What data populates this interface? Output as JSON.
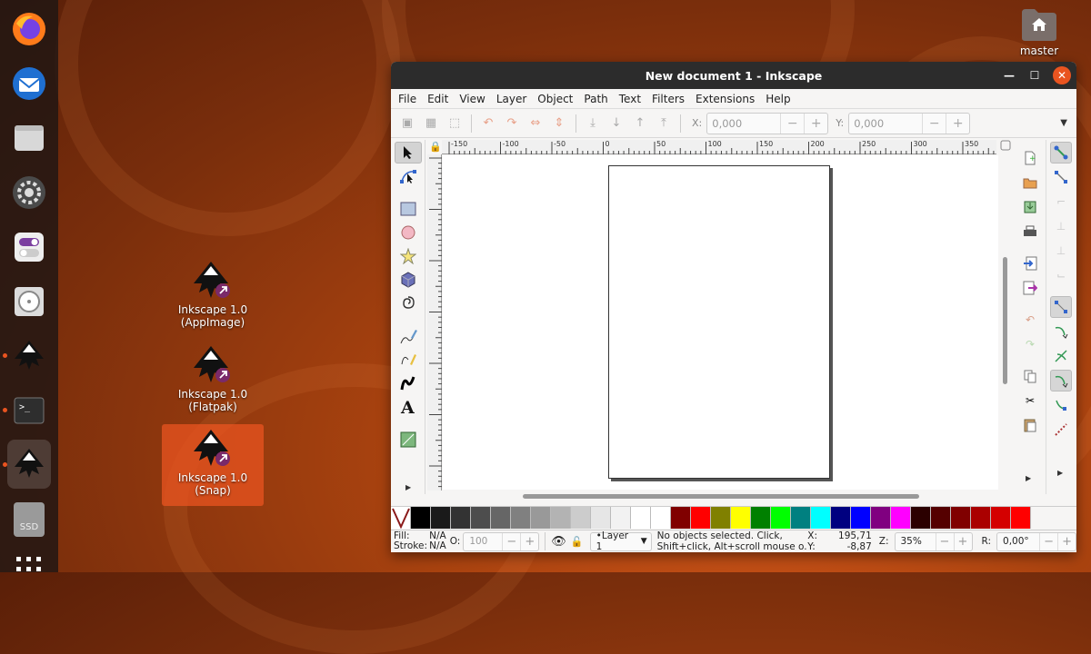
{
  "desktop": {
    "home_folder_label": "master",
    "icons": [
      {
        "label_line1": "Inkscape 1.0",
        "label_line2": "(AppImage)"
      },
      {
        "label_line1": "Inkscape 1.0",
        "label_line2": "(Flatpak)"
      },
      {
        "label_line1": "Inkscape 1.0 (Snap)",
        "label_line2": ""
      }
    ]
  },
  "dock": {
    "items": [
      "firefox-icon",
      "thunderbird-icon",
      "files-icon",
      "settings-icon",
      "tweaks-icon",
      "disks-icon",
      "inkscape-icon",
      "terminal-icon",
      "inkscape-icon",
      "ssd-icon",
      "apps-grid-icon"
    ],
    "ssd_label": "SSD"
  },
  "window": {
    "title": "New document 1 - Inkscape",
    "menu": [
      "File",
      "Edit",
      "View",
      "Layer",
      "Object",
      "Path",
      "Text",
      "Filters",
      "Extensions",
      "Help"
    ],
    "x_label": "X:",
    "x_value": "0,000",
    "y_label": "Y:",
    "y_value": "0,000"
  },
  "ruler": {
    "h_ticks": [
      "-150",
      "-100",
      "-50",
      "0",
      "50",
      "100",
      "150",
      "200",
      "250",
      "300",
      "350"
    ]
  },
  "palette": [
    "#ffffff",
    "#000000",
    "#1a1a1a",
    "#333333",
    "#4d4d4d",
    "#666666",
    "#808080",
    "#999999",
    "#b3b3b3",
    "#cccccc",
    "#e6e6e6",
    "#f2f2f2",
    "#ffffff",
    "#ffffff",
    "#800000",
    "#ff0000",
    "#808000",
    "#ffff00",
    "#008000",
    "#00ff00",
    "#008080",
    "#00ffff",
    "#000080",
    "#0000ff",
    "#800080",
    "#ff00ff",
    "#2b0000",
    "#550000",
    "#800000",
    "#aa0000",
    "#d40000",
    "#ff0000"
  ],
  "status": {
    "fill_label": "Fill:",
    "fill_value": "N/A",
    "stroke_label": "Stroke:",
    "stroke_value": "N/A",
    "opacity_label": "O:",
    "opacity_value": "100",
    "layer": "•Layer 1",
    "message_line1": "No objects selected. Click,",
    "message_line2": "Shift+click, Alt+scroll mouse o...",
    "x_label": "X:",
    "x_value": "195,71",
    "y_label": "Y:",
    "y_value": "-8,87",
    "zoom_label": "Z:",
    "zoom_value": "35%",
    "rotate_label": "R:",
    "rotate_value": "0,00°"
  }
}
